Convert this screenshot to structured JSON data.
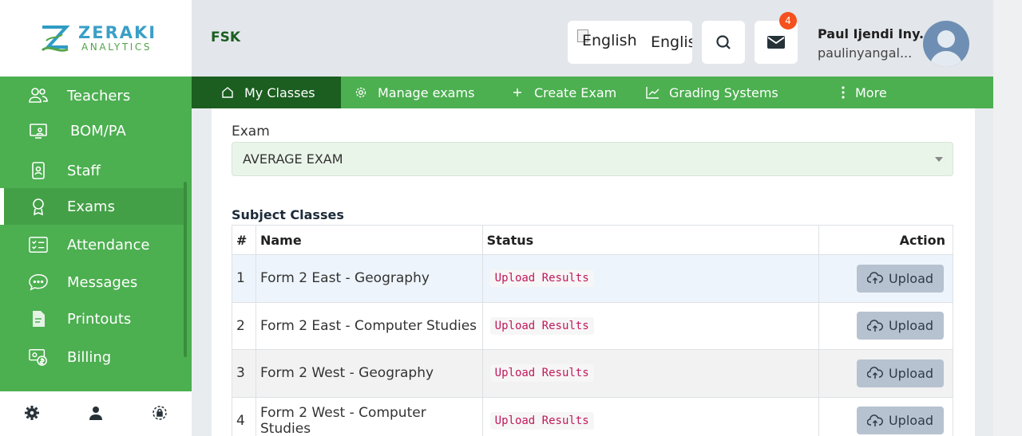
{
  "brand": {
    "title": "ZERAKI",
    "subtitle": "ANALYTICS"
  },
  "sidebar": {
    "items": [
      {
        "label": "Teachers",
        "icon": "users-icon"
      },
      {
        "label": "BOM/PA",
        "icon": "monitor-user-icon"
      },
      {
        "label": "Staff",
        "icon": "id-badge-icon"
      },
      {
        "label": "Exams",
        "icon": "award-icon",
        "active": true
      },
      {
        "label": "Attendance",
        "icon": "checklist-icon"
      },
      {
        "label": "Messages",
        "icon": "chat-icon"
      },
      {
        "label": "Printouts",
        "icon": "document-icon"
      },
      {
        "label": "Billing",
        "icon": "billing-icon"
      }
    ],
    "footer_icons": [
      "gear-icon",
      "person-icon",
      "lock-icon"
    ]
  },
  "header": {
    "org": "FSK",
    "language_alt": "English",
    "language_label": "English",
    "notification_count": "4",
    "user_name": "Paul Ijendi Iny...",
    "user_email": "paulinyangal..."
  },
  "tabs": [
    {
      "label": "My Classes",
      "icon": "home-icon",
      "active": true
    },
    {
      "label": "Manage exams",
      "icon": "gear-icon"
    },
    {
      "label": "Create Exam",
      "icon": "plus-icon"
    },
    {
      "label": "Grading Systems",
      "icon": "chart-line-icon"
    },
    {
      "label": "More",
      "icon": "vertical-dots-icon"
    }
  ],
  "exam": {
    "label": "Exam",
    "selected": "AVERAGE EXAM"
  },
  "subject_classes": {
    "title": "Subject Classes",
    "columns": [
      "#",
      "Name",
      "Status",
      "Action"
    ],
    "rows": [
      {
        "num": "1",
        "name": "Form 2 East - Geography",
        "status": "Upload Results",
        "action": "Upload"
      },
      {
        "num": "2",
        "name": "Form 2 East - Computer Studies",
        "status": "Upload Results",
        "action": "Upload"
      },
      {
        "num": "3",
        "name": "Form 2 West - Geography",
        "status": "Upload Results",
        "action": "Upload"
      },
      {
        "num": "4",
        "name": "Form 2 West - Computer Studies",
        "status": "Upload Results",
        "action": "Upload"
      }
    ]
  },
  "colors": {
    "sidebar_green": "#4caf50",
    "active_tab": "#1b5e20",
    "status_pink": "#c2185b",
    "badge": "#f4511e"
  }
}
